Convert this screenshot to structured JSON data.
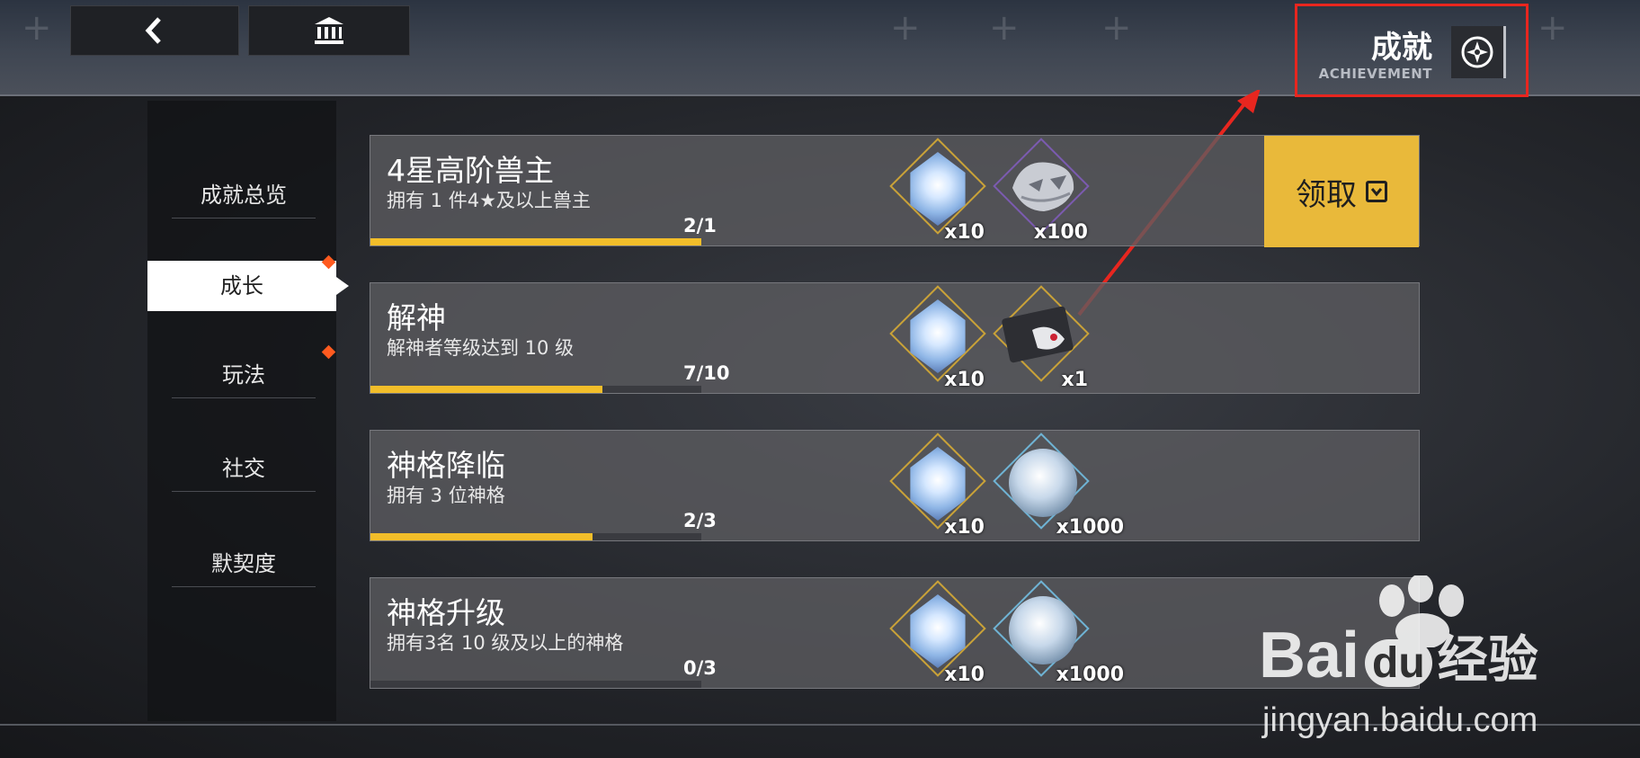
{
  "header": {
    "title_cn": "成就",
    "title_en": "ACHIEVEMENT",
    "back_icon": "chevron-left-icon",
    "home_icon": "bank-building-icon",
    "achievement_icon": "compass-star-icon"
  },
  "sidebar": {
    "items": [
      {
        "label": "成就总览",
        "active": false,
        "dot": false
      },
      {
        "label": "成长",
        "active": true,
        "dot": true
      },
      {
        "label": "玩法",
        "active": false,
        "dot": true
      },
      {
        "label": "社交",
        "active": false,
        "dot": false
      },
      {
        "label": "默契度",
        "active": false,
        "dot": false
      }
    ]
  },
  "achievements": [
    {
      "title": "4星高阶兽主",
      "desc": "拥有 1 件4★及以上兽主",
      "progress_text": "2/1",
      "progress": 1.0,
      "rewards": [
        {
          "icon": "crystal-icon",
          "qty": "x10"
        },
        {
          "icon": "beast-helmet-icon",
          "qty": "x100"
        }
      ],
      "claim_label": "领取"
    },
    {
      "title": "解神",
      "desc": "解神者等级达到 10 级",
      "progress_text": "7/10",
      "progress": 0.7,
      "rewards": [
        {
          "icon": "crystal-icon",
          "qty": "x10"
        },
        {
          "icon": "karma-card-icon",
          "qty": "x1"
        }
      ]
    },
    {
      "title": "神格降临",
      "desc": "拥有 3 位神格",
      "progress_text": "2/3",
      "progress": 0.67,
      "rewards": [
        {
          "icon": "crystal-icon",
          "qty": "x10"
        },
        {
          "icon": "divinity-sphere-icon",
          "qty": "x1000"
        }
      ]
    },
    {
      "title": "神格升级",
      "desc": "拥有3名 10 级及以上的神格",
      "progress_text": "0/3",
      "progress": 0.0,
      "rewards": [
        {
          "icon": "crystal-icon",
          "qty": "x10"
        },
        {
          "icon": "divinity-sphere-icon",
          "qty": "x1000"
        }
      ]
    }
  ],
  "watermark": {
    "brand": "Bai",
    "brand_du": "du",
    "brand_cn": "经验",
    "url": "jingyan.baidu.com"
  },
  "colors": {
    "accent_yellow": "#e9b93a",
    "progress_yellow": "#f2be2a",
    "highlight_red": "#e8261f",
    "dot_orange": "#ff5a1f"
  }
}
